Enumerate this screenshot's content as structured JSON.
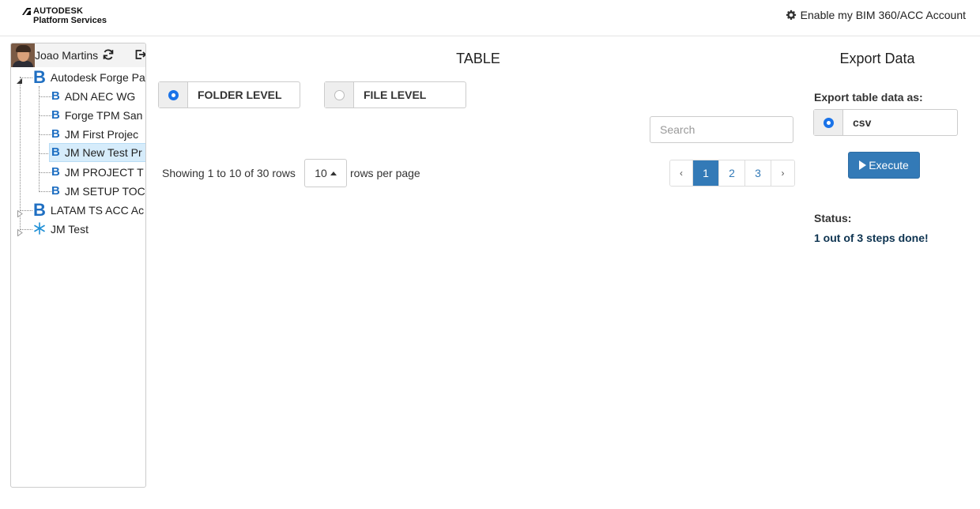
{
  "header": {
    "logo_line1": "AUTODESK",
    "logo_line2": "Platform Services",
    "enable_link": "Enable my BIM 360/ACC Account",
    "enable_icon": "gear-icon"
  },
  "sidebar": {
    "user_name": "Joao Martins",
    "tree": [
      {
        "label": "Autodesk Forge Pa",
        "icon": "bim360-b-icon",
        "level": 0,
        "expanded": true
      },
      {
        "label": "ADN AEC WG",
        "icon": "bim360-b-icon",
        "level": 1
      },
      {
        "label": "Forge TPM San",
        "icon": "bim360-b-icon",
        "level": 1
      },
      {
        "label": "JM First Projec",
        "icon": "bim360-b-icon",
        "level": 1
      },
      {
        "label": "JM New Test Pr",
        "icon": "bim360-b-icon",
        "level": 1,
        "selected": true
      },
      {
        "label": "JM PROJECT T",
        "icon": "bim360-b-icon",
        "level": 1
      },
      {
        "label": "JM SETUP TOC",
        "icon": "bim360-b-icon",
        "level": 1
      },
      {
        "label": "LATAM TS ACC Ac",
        "icon": "bim360-b-icon",
        "level": 0,
        "expanded": false
      },
      {
        "label": "JM Test",
        "icon": "snowflake-icon",
        "level": 0,
        "expanded": false
      }
    ]
  },
  "table_panel": {
    "title": "TABLE",
    "options": [
      {
        "label": "FOLDER LEVEL",
        "selected": true
      },
      {
        "label": "FILE LEVEL",
        "selected": false
      }
    ],
    "search_placeholder": "Search",
    "showing_text": "Showing 1 to 10 of 30 rows",
    "page_size": "10",
    "rows_per_page": "rows per page",
    "pagination": {
      "prev": "‹",
      "pages": [
        "1",
        "2",
        "3"
      ],
      "active_page": "1",
      "next": "›"
    }
  },
  "export_panel": {
    "title": "Export Data",
    "label": "Export table data as:",
    "format_option": "csv",
    "format_selected": true,
    "execute_label": "Execute",
    "status_label": "Status:",
    "status_value": "1 out of 3 steps done!"
  },
  "colors": {
    "primary": "#337ab7",
    "bim_blue": "#1f6fc2",
    "status_text": "#0d3350",
    "selected_node": "#d6ecfb"
  }
}
